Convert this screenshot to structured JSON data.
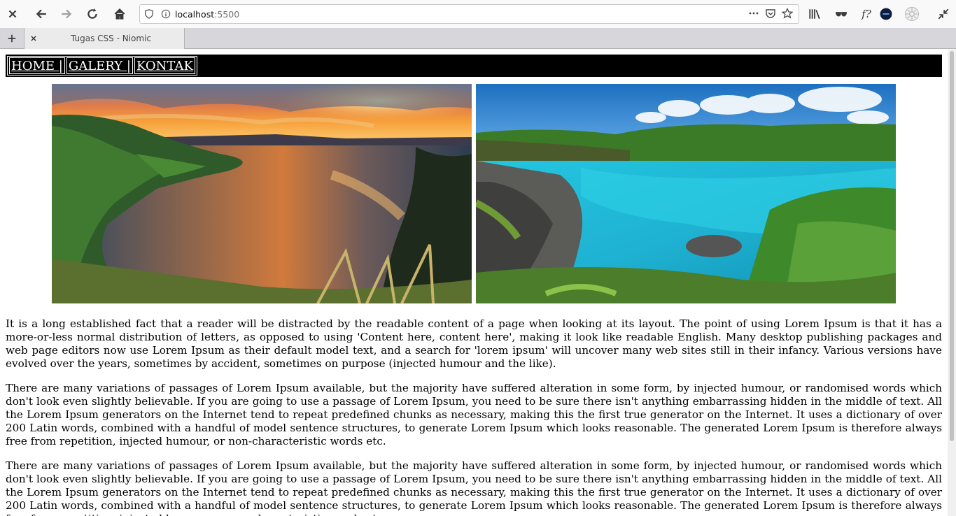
{
  "browser": {
    "url_host": "localhost",
    "url_port": ":5500",
    "tab_title": "Tugas CSS - Niomic",
    "icons": [
      "close-icon",
      "back-icon",
      "forward-icon",
      "reload-icon",
      "home-icon",
      "shield-icon",
      "info-icon",
      "more-icon",
      "pocket-icon",
      "bookmark-star-icon",
      "library-icon",
      "reader-mask-icon",
      "formula-icon",
      "avatar-icon",
      "gear-icon",
      "collapse-icon",
      "new-tab-icon",
      "tab-close-icon"
    ]
  },
  "nav": {
    "items": [
      {
        "label": "HOME |"
      },
      {
        "label": "GALERY |"
      },
      {
        "label": "KONTAK"
      }
    ],
    "background": "#000000",
    "text_color": "#ffffff"
  },
  "gallery": {
    "images": [
      {
        "name": "lake-sunset"
      },
      {
        "name": "turquoise-lagoon"
      }
    ]
  },
  "article": {
    "paragraphs": [
      "It is a long established fact that a reader will be distracted by the readable content of a page when looking at its layout. The point of using Lorem Ipsum is that it has a more-or-less normal distribution of letters, as opposed to using 'Content here, content here', making it look like readable English. Many desktop publishing packages and web page editors now use Lorem Ipsum as their default model text, and a search for 'lorem ipsum' will uncover many web sites still in their infancy. Various versions have evolved over the years, sometimes by accident, sometimes on purpose (injected humour and the like).",
      "There are many variations of passages of Lorem Ipsum available, but the majority have suffered alteration in some form, by injected humour, or randomised words which don't look even slightly believable. If you are going to use a passage of Lorem Ipsum, you need to be sure there isn't anything embarrassing hidden in the middle of text. All the Lorem Ipsum generators on the Internet tend to repeat predefined chunks as necessary, making this the first true generator on the Internet. It uses a dictionary of over 200 Latin words, combined with a handful of model sentence structures, to generate Lorem Ipsum which looks reasonable. The generated Lorem Ipsum is therefore always free from repetition, injected humour, or non-characteristic words etc.",
      "There are many variations of passages of Lorem Ipsum available, but the majority have suffered alteration in some form, by injected humour, or randomised words which don't look even slightly believable. If you are going to use a passage of Lorem Ipsum, you need to be sure there isn't anything embarrassing hidden in the middle of text. All the Lorem Ipsum generators on the Internet tend to repeat predefined chunks as necessary, making this the first true generator on the Internet. It uses a dictionary of over 200 Latin words, combined with a handful of model sentence structures, to generate Lorem Ipsum which looks reasonable. The generated Lorem Ipsum is therefore always free from repetition, injected humour, or non-characteristic words etc."
    ]
  }
}
